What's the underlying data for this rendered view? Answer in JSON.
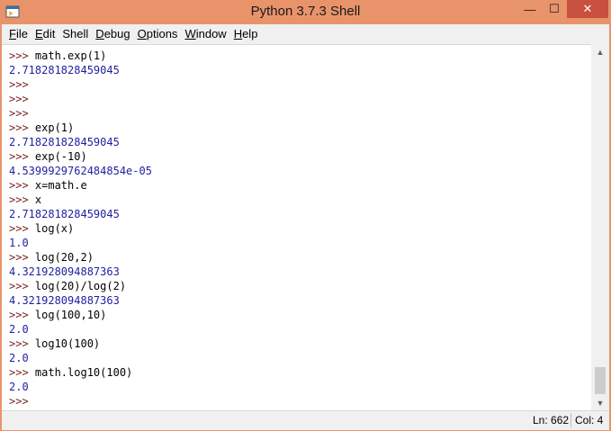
{
  "window": {
    "title": "Python 3.7.3 Shell",
    "controls": {
      "minimize": "—",
      "maximize": "☐",
      "close": "✕"
    }
  },
  "menu": [
    {
      "label": "File",
      "u": "F",
      "rest": "ile"
    },
    {
      "label": "Edit",
      "u": "E",
      "rest": "dit"
    },
    {
      "label": "Shell",
      "u": "",
      "rest": "Shell"
    },
    {
      "label": "Debug",
      "u": "D",
      "rest": "ebug"
    },
    {
      "label": "Options",
      "u": "O",
      "rest": "ptions"
    },
    {
      "label": "Window",
      "u": "W",
      "rest": "indow"
    },
    {
      "label": "Help",
      "u": "H",
      "rest": "elp"
    }
  ],
  "shell_lines": [
    {
      "prompt": ">>> ",
      "text": "math.exp(1)",
      "kind": "input"
    },
    {
      "prompt": "",
      "text": "2.718281828459045",
      "kind": "output"
    },
    {
      "prompt": ">>>",
      "text": "",
      "kind": "input"
    },
    {
      "prompt": ">>>",
      "text": "",
      "kind": "input"
    },
    {
      "prompt": ">>>",
      "text": "",
      "kind": "input"
    },
    {
      "prompt": ">>> ",
      "text": "exp(1)",
      "kind": "input"
    },
    {
      "prompt": "",
      "text": "2.718281828459045",
      "kind": "output"
    },
    {
      "prompt": ">>> ",
      "text": "exp(-10)",
      "kind": "input"
    },
    {
      "prompt": "",
      "text": "4.5399929762484854e-05",
      "kind": "output"
    },
    {
      "prompt": ">>> ",
      "text": "x=math.e",
      "kind": "input"
    },
    {
      "prompt": ">>> ",
      "text": "x",
      "kind": "input"
    },
    {
      "prompt": "",
      "text": "2.718281828459045",
      "kind": "output"
    },
    {
      "prompt": ">>> ",
      "text": "log(x)",
      "kind": "input"
    },
    {
      "prompt": "",
      "text": "1.0",
      "kind": "output"
    },
    {
      "prompt": ">>> ",
      "text": "log(20,2)",
      "kind": "input"
    },
    {
      "prompt": "",
      "text": "4.321928094887363",
      "kind": "output"
    },
    {
      "prompt": ">>> ",
      "text": "log(20)/log(2)",
      "kind": "input"
    },
    {
      "prompt": "",
      "text": "4.321928094887363",
      "kind": "output"
    },
    {
      "prompt": ">>> ",
      "text": "log(100,10)",
      "kind": "input"
    },
    {
      "prompt": "",
      "text": "2.0",
      "kind": "output"
    },
    {
      "prompt": ">>> ",
      "text": "log10(100)",
      "kind": "input"
    },
    {
      "prompt": "",
      "text": "2.0",
      "kind": "output"
    },
    {
      "prompt": ">>> ",
      "text": "math.log10(100)",
      "kind": "input"
    },
    {
      "prompt": "",
      "text": "2.0",
      "kind": "output"
    },
    {
      "prompt": ">>>",
      "text": "",
      "kind": "input"
    }
  ],
  "status": {
    "ln": "Ln: 662",
    "col": "Col: 4"
  },
  "colors": {
    "titlebar": "#e9936b",
    "prompt": "#7a1f1f",
    "output": "#1f1fa0"
  }
}
